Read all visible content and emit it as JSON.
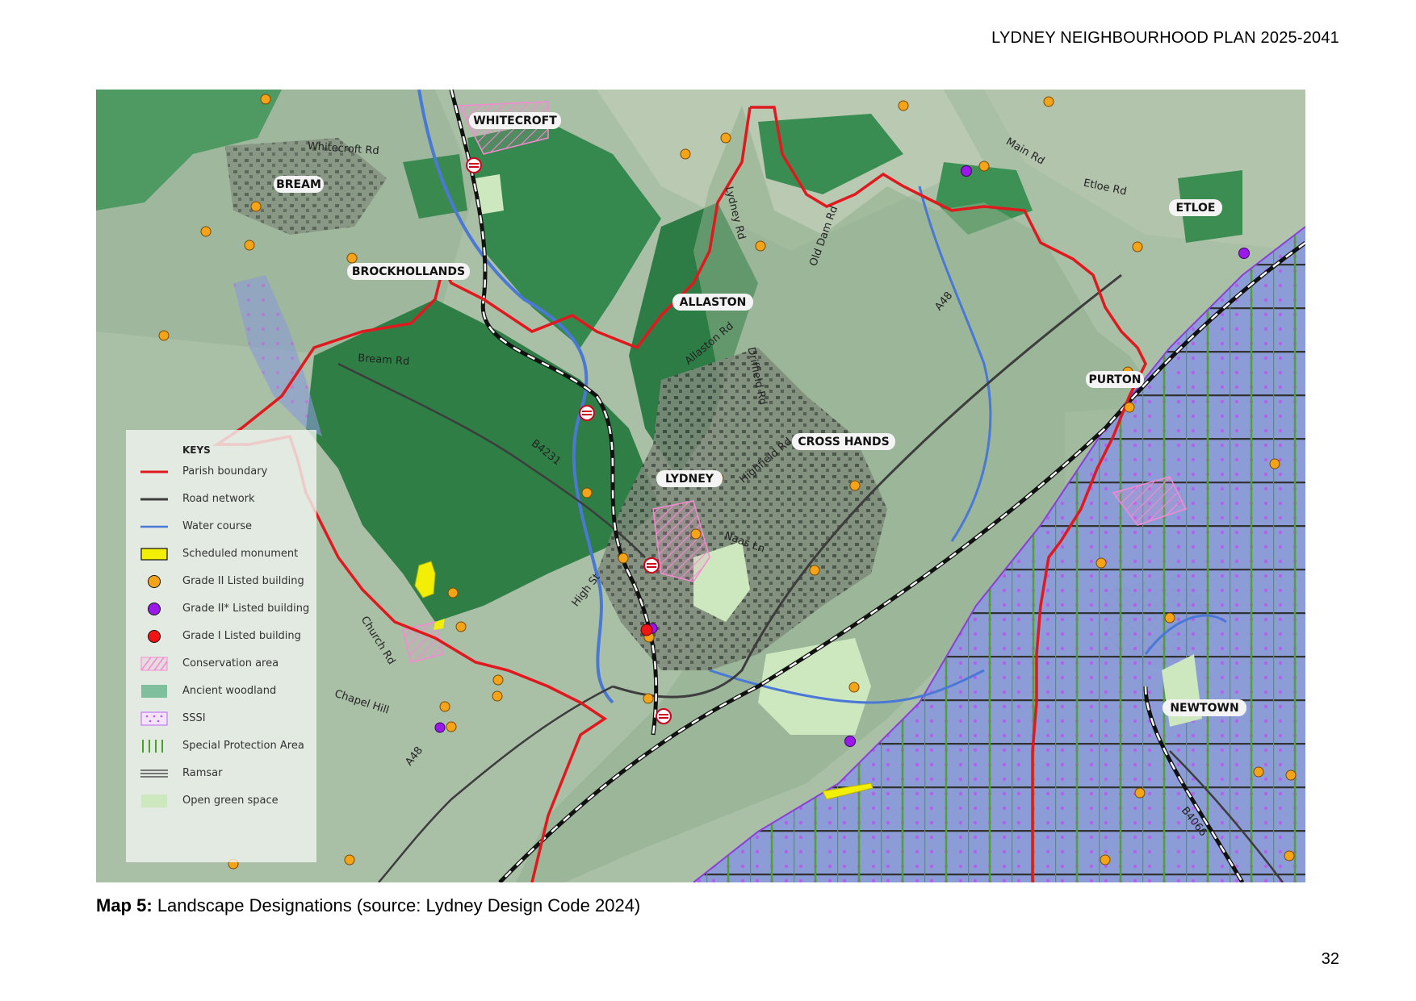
{
  "header": {
    "title": "LYDNEY NEIGHBOURHOOD PLAN 2025-2041"
  },
  "map": {
    "places": {
      "whitecroft": "WHITECROFT",
      "bream": "BREAM",
      "brockhollands": "BROCKHOLLANDS",
      "allaston": "ALLASTON",
      "etloe": "ETLOE",
      "purton": "PURTON",
      "cross_hands": "CROSS HANDS",
      "lydney": "LYDNEY",
      "newtown": "NEWTOWN"
    },
    "roads": {
      "whitecroft_rd": "Whitecroft Rd",
      "bream_rd": "Bream Rd",
      "lydney_rd": "Lydney Rd",
      "old_dam_rd": "Old Dam Rd",
      "main_rd": "Main Rd",
      "etloe_rd": "Etloe Rd",
      "a48_north": "A48",
      "allaston_rd": "Allaston Rd",
      "driffield_rd": "Driffield Rd",
      "b4231": "B4231",
      "highfield_rd": "Highfield Rd",
      "naas_ln": "Naas Ln",
      "high_st": "High St",
      "church_rd": "Church Rd",
      "chapel_hill": "Chapel Hill",
      "a48_south": "A48",
      "b4066": "B4066"
    },
    "colors": {
      "parish_boundary": "#e0191f",
      "road_network": "#3d3d3d",
      "water_course": "#4a78d6",
      "scheduled_monument": "#f2ee05",
      "grade_ii": "#f5a41a",
      "grade_ii_star": "#9b19e8",
      "grade_i": "#f01414",
      "conservation_area": "#f58ad3",
      "ancient_woodland": "#7fbf9e",
      "sssi": "#c37af2",
      "special_protection_area": "#4aa02c",
      "ramsar": "#333333",
      "open_green_space": "#cde8be"
    }
  },
  "legend": {
    "title": "KEYS",
    "items": [
      {
        "key": "parish_boundary",
        "label": "Parish boundary"
      },
      {
        "key": "road_network",
        "label": "Road network"
      },
      {
        "key": "water_course",
        "label": "Water course"
      },
      {
        "key": "scheduled_monument",
        "label": "Scheduled monument"
      },
      {
        "key": "grade_ii",
        "label": "Grade II Listed building"
      },
      {
        "key": "grade_ii_star",
        "label": "Grade II* Listed building"
      },
      {
        "key": "grade_i",
        "label": "Grade I Listed building"
      },
      {
        "key": "conservation_area",
        "label": "Conservation area"
      },
      {
        "key": "ancient_woodland",
        "label": "Ancient woodland"
      },
      {
        "key": "sssi",
        "label": "SSSI"
      },
      {
        "key": "special_protection_area",
        "label": "Special Protection Area"
      },
      {
        "key": "ramsar",
        "label": "Ramsar"
      },
      {
        "key": "open_green_space",
        "label": "Open green space"
      }
    ]
  },
  "caption": {
    "label": "Map 5:",
    "text": "Landscape Designations (source: Lydney Design Code 2024)"
  },
  "page_number": "32"
}
